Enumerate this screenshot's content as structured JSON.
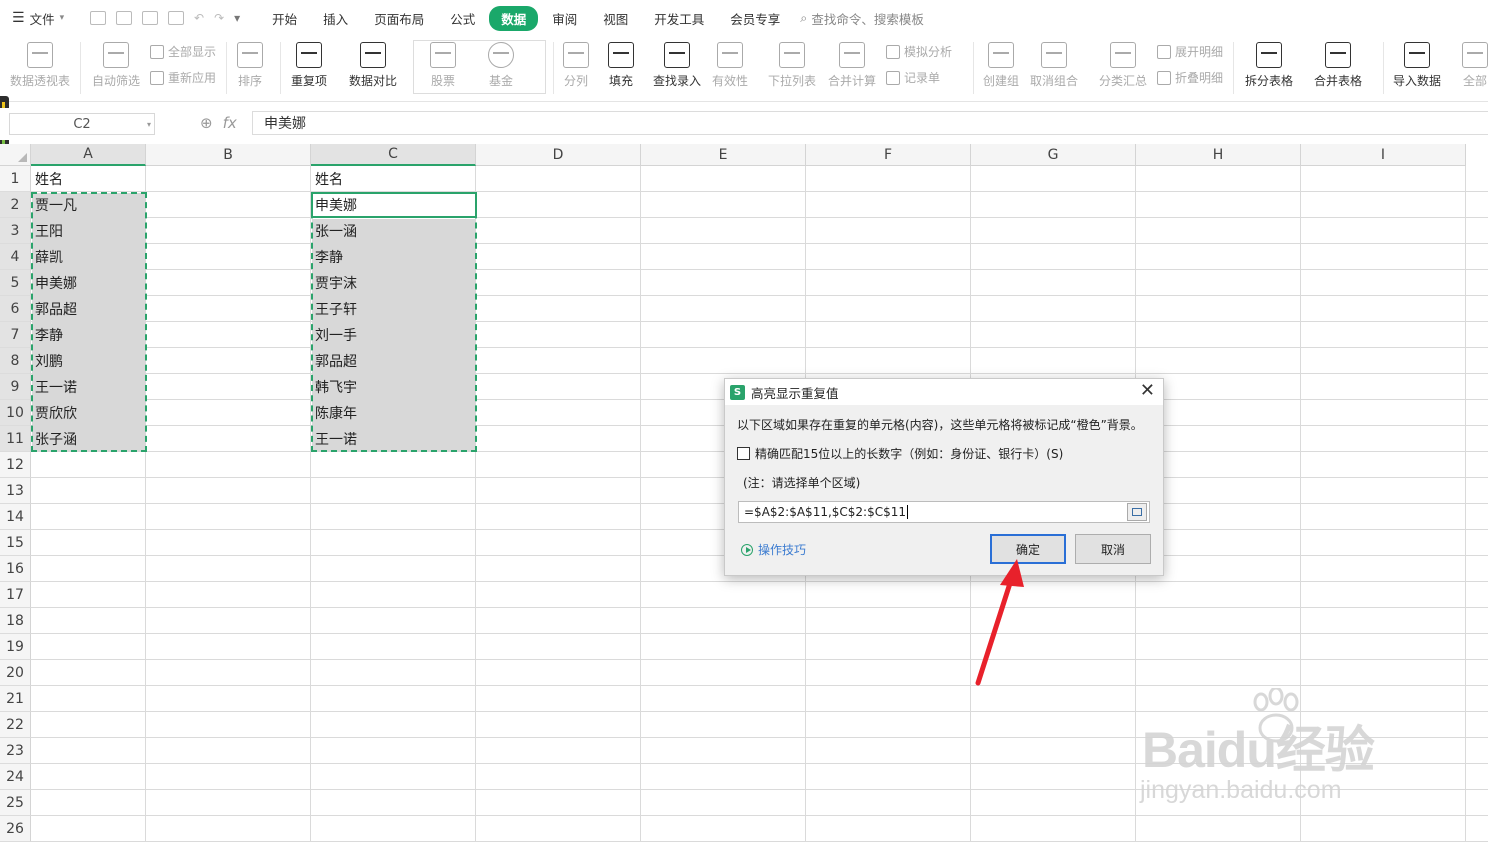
{
  "menubar": {
    "file_label": "文件",
    "tabs": [
      "开始",
      "插入",
      "页面布局",
      "公式",
      "数据",
      "审阅",
      "视图",
      "开发工具",
      "会员专享"
    ],
    "active_tab": "数据",
    "search_placeholder": "查找命令、搜索模板"
  },
  "ribbon": {
    "pivot": "数据透视表",
    "autofilter": "自动筛选",
    "show_all": "全部显示",
    "reapply": "重新应用",
    "sort": "排序",
    "duplicates": "重复项",
    "compare": "数据对比",
    "stock": "股票",
    "fund": "基金",
    "split_col": "分列",
    "fill": "填充",
    "find_entry": "查找录入",
    "validity": "有效性",
    "dropdown_list": "下拉列表",
    "consolidate": "合并计算",
    "what_if": "模拟分析",
    "record_form": "记录单",
    "create_group": "创建组",
    "ungroup": "取消组合",
    "subtotal": "分类汇总",
    "expand_detail": "展开明细",
    "collapse_detail": "折叠明细",
    "split_table": "拆分表格",
    "merge_table": "合并表格",
    "import_data": "导入数据",
    "all": "全部"
  },
  "formula_bar": {
    "cell_ref": "C2",
    "fx_label": "fx",
    "content": "申美娜"
  },
  "sheet": {
    "columns": [
      "A",
      "B",
      "C",
      "D",
      "E",
      "F",
      "G",
      "H",
      "I"
    ],
    "rows": [
      "1",
      "2",
      "3",
      "4",
      "5",
      "6",
      "7",
      "8",
      "9",
      "10",
      "11",
      "12",
      "13",
      "14",
      "15",
      "16",
      "17",
      "18",
      "19",
      "20",
      "21",
      "22",
      "23",
      "24",
      "25",
      "26"
    ],
    "col_a": [
      "姓名",
      "贾一凡",
      "王阳",
      "薛凯",
      "申美娜",
      "郭品超",
      "李静",
      "刘鹏",
      "王一诺",
      "贾欣欣",
      "张子涵"
    ],
    "col_c": [
      "姓名",
      "申美娜",
      "张一涵",
      "李静",
      "贾宇沫",
      "王子轩",
      "刘一手",
      "郭品超",
      "韩飞宇",
      "陈康年",
      "王一诺"
    ]
  },
  "dialog": {
    "app_icon": "S",
    "title": "高亮显示重复值",
    "close": "✕",
    "description": "以下区域如果存在重复的单元格(内容)，这些单元格将被标记成“橙色”背景。",
    "checkbox_label": "精确匹配15位以上的长数字（例如：身份证、银行卡）(S)",
    "note": "(注：请选择单个区域)",
    "range_value": "=$A$2:$A$11,$C$2:$C$11",
    "tips_label": "操作技巧",
    "ok_label": "确定",
    "cancel_label": "取消"
  },
  "watermark": {
    "brand": "Baidu经验",
    "url": "jingyan.baidu.com"
  },
  "colors": {
    "accent_green": "#1aa86a",
    "arrow_red": "#e8212b",
    "ok_border": "#2a6fd6"
  }
}
